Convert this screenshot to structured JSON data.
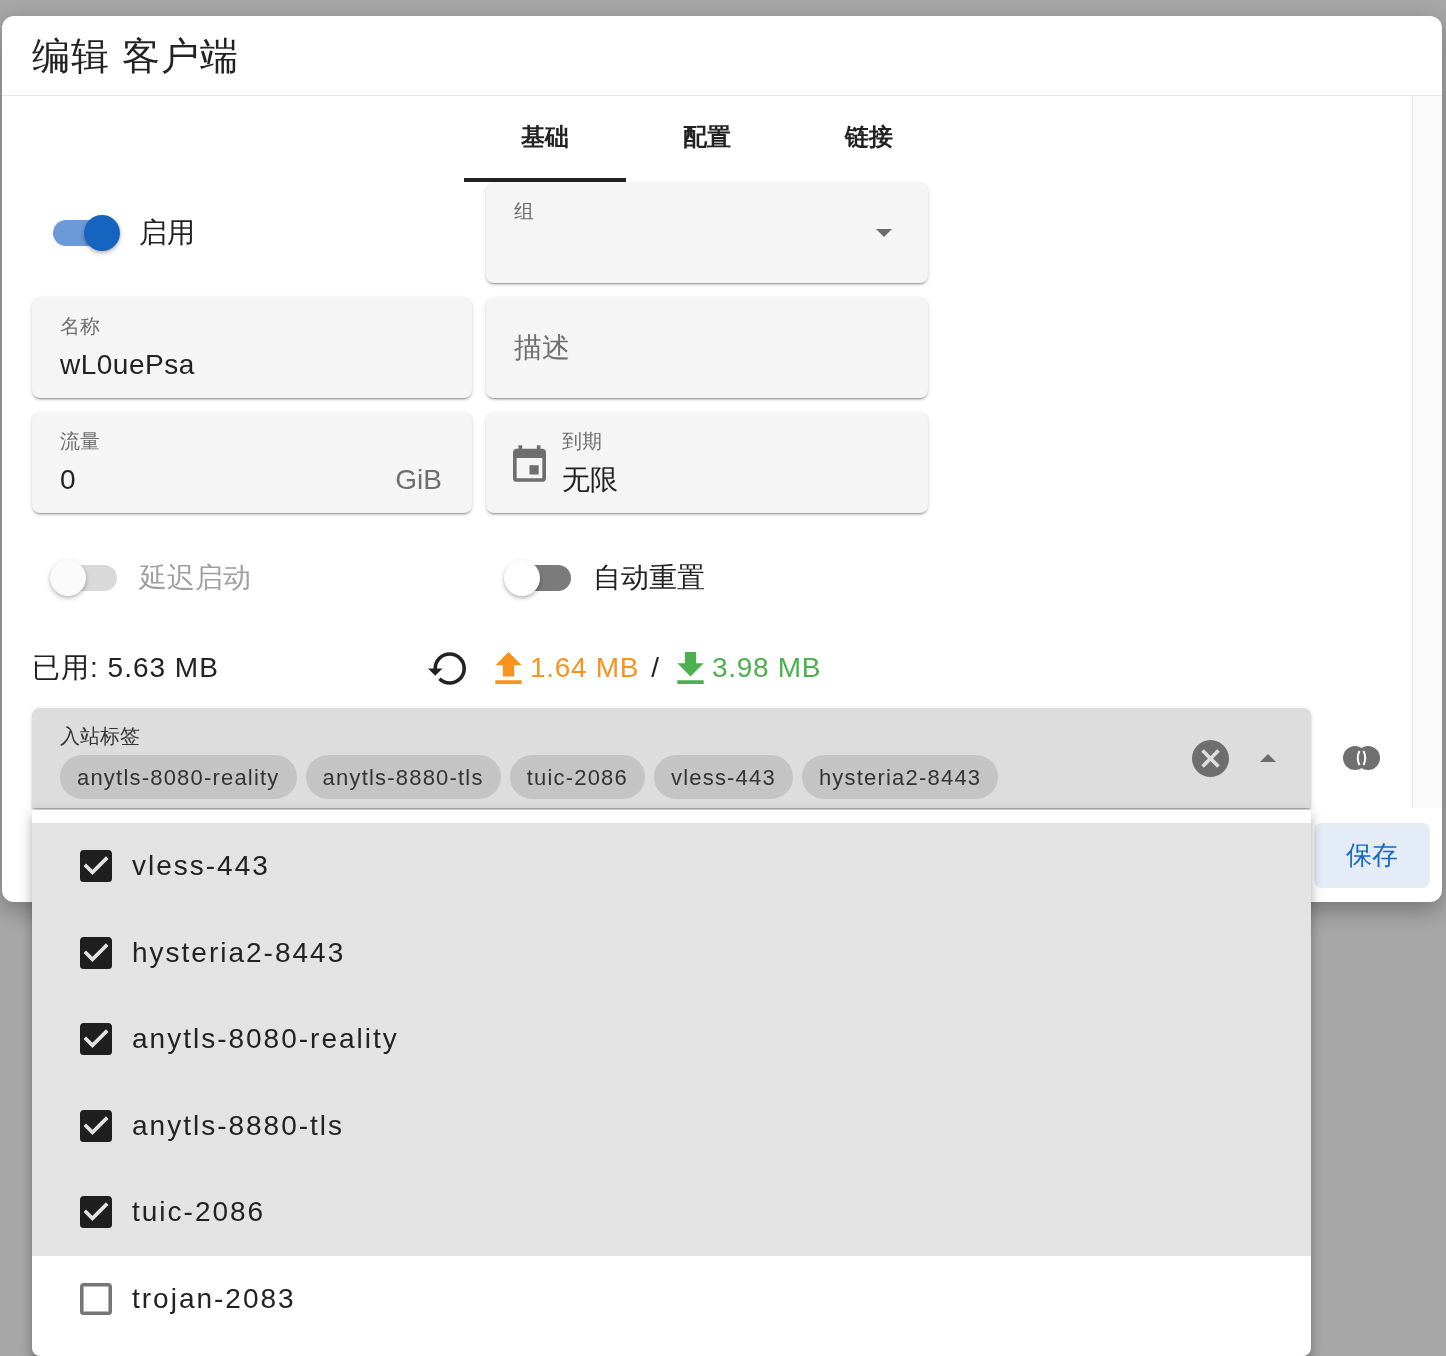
{
  "dialog": {
    "title": "编辑 客户端"
  },
  "tabs": [
    {
      "label": "基础",
      "selected": true
    },
    {
      "label": "配置",
      "selected": false
    },
    {
      "label": "链接",
      "selected": false
    }
  ],
  "form": [
    {
      "kind": "switch",
      "label": "启用",
      "on": true,
      "disabled": false
    },
    {
      "kind": "select",
      "label": "组"
    },
    {
      "kind": "text",
      "label": "名称",
      "value": "wL0uePsa"
    },
    {
      "kind": "text",
      "label": "描述"
    },
    {
      "kind": "text",
      "label": "流量",
      "value": "0",
      "suffix": "GiB"
    },
    {
      "kind": "date",
      "label": "到期",
      "value": "无限"
    },
    {
      "kind": "switch",
      "label": "延迟启动",
      "on": false,
      "disabled": true
    },
    {
      "kind": "switch",
      "label": "自动重置",
      "on": false,
      "disabled": false
    }
  ],
  "usage": {
    "used": "已用: 5.63 MB",
    "upload": "1.64 MB",
    "separator": "/",
    "download": "3.98 MB"
  },
  "inbound_tags": {
    "label": "入站标签",
    "chips": [
      "anytls-8080-reality",
      "anytls-8880-tls",
      "tuic-2086",
      "vless-443",
      "hysteria2-8443"
    ],
    "expanded": true,
    "options": [
      {
        "label": "vless-443",
        "selected": true
      },
      {
        "label": "hysteria2-8443",
        "selected": true
      },
      {
        "label": "anytls-8080-reality",
        "selected": true
      },
      {
        "label": "anytls-8880-tls",
        "selected": true
      },
      {
        "label": "tuic-2086",
        "selected": true
      },
      {
        "label": "trojan-2083",
        "selected": false
      }
    ]
  },
  "buttons": [
    {
      "label": "保存"
    }
  ]
}
